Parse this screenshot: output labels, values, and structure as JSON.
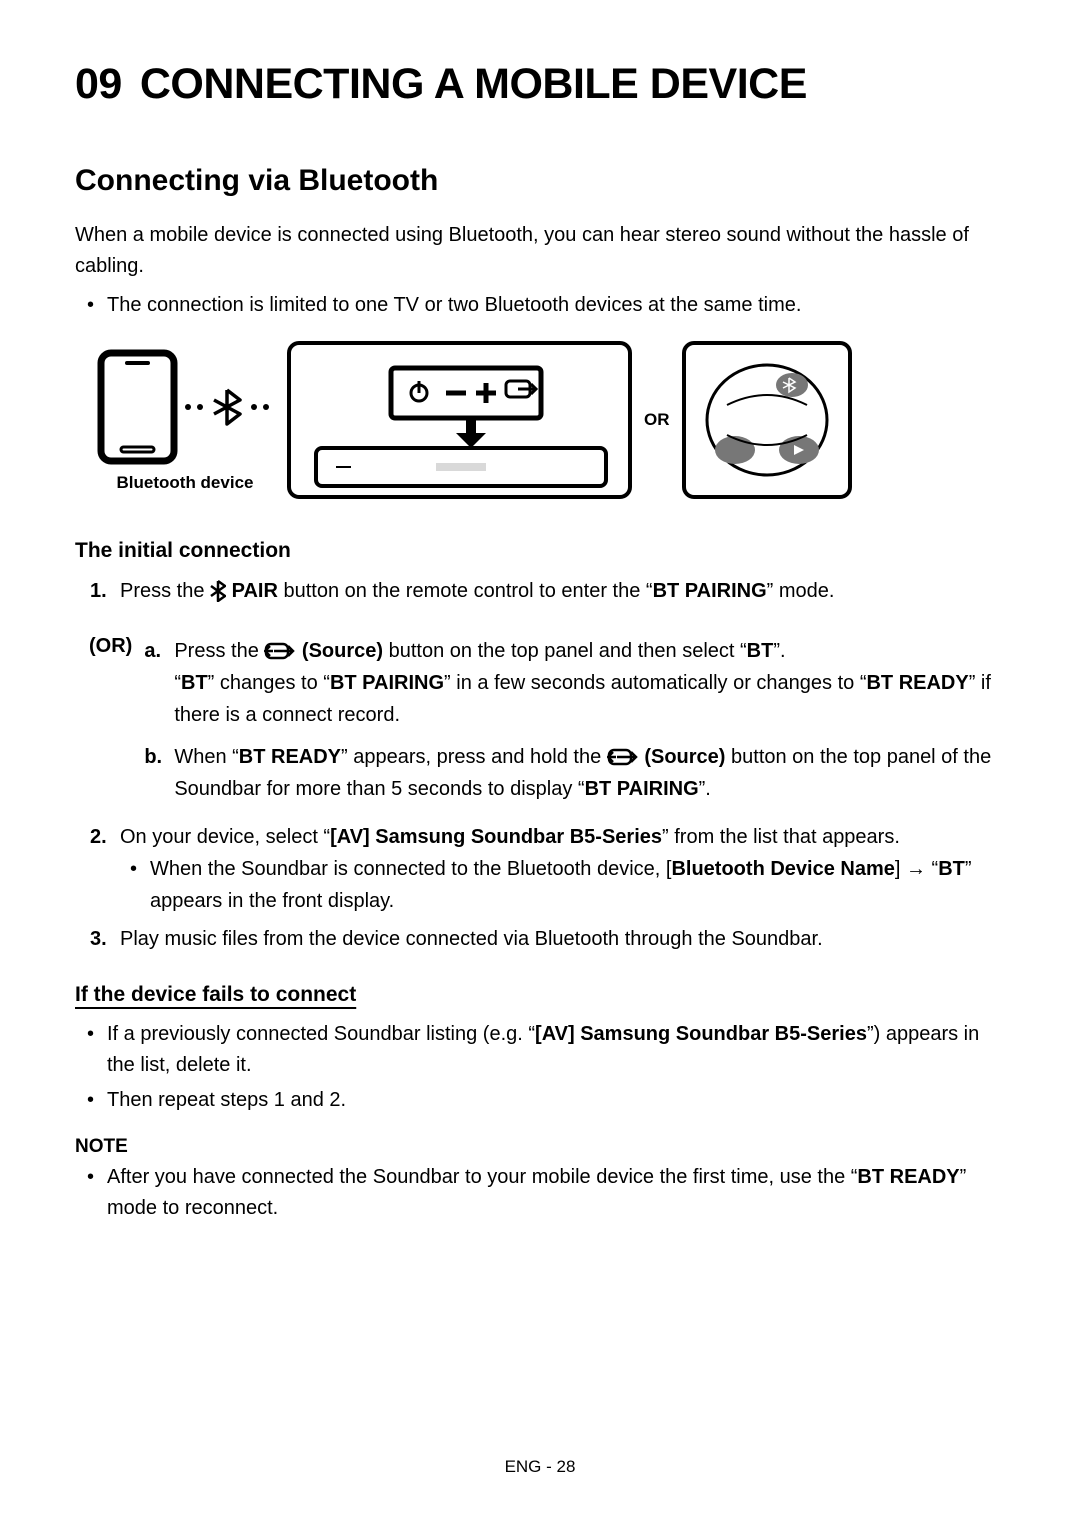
{
  "header": {
    "chapter_number": "09",
    "chapter_title": "CONNECTING A MOBILE DEVICE"
  },
  "section1": {
    "title": "Connecting via Bluetooth",
    "intro": "When a mobile device is connected using Bluetooth, you can hear stereo sound without the hassle of cabling.",
    "bullet1": "The connection is limited to one TV or two Bluetooth devices at the same time."
  },
  "figure": {
    "phone_label": "Bluetooth device",
    "or_label": "OR"
  },
  "initial": {
    "heading": "The initial connection",
    "step1_num": "1.",
    "step1_pre": "Press the ",
    "step1_pair": " PAIR",
    "step1_mid": " button on the remote control to enter the “",
    "step1_btpair": "BT PAIRING",
    "step1_end": "” mode.",
    "or_tag": "(OR)",
    "a_num": "a.",
    "a_pre": "Press the ",
    "a_src": " (Source)",
    "a_mid": " button on the top panel and then select “",
    "a_bt": "BT",
    "a_end": "”.",
    "a_line2_pre": "“",
    "a_line2_bt": "BT",
    "a_line2_mid": "” changes to “",
    "a_line2_btpair": "BT PAIRING",
    "a_line2_mid2": "” in a few seconds automatically or changes to “",
    "a_line2_btready": "BT READY",
    "a_line2_end": "” if there is a connect record.",
    "b_num": "b.",
    "b_pre": "When “",
    "b_btready": "BT READY",
    "b_mid": "” appears, press and hold the ",
    "b_src": " (Source)",
    "b_mid2": " button on the top panel of the Soundbar for more than 5 seconds to display “",
    "b_btpair": "BT PAIRING",
    "b_end": "”.",
    "step2_num": "2.",
    "step2_pre": "On your device, select “",
    "step2_device": "[AV] Samsung Soundbar B5-Series",
    "step2_end": "” from the list that appears.",
    "step2_sub_pre": "When the Soundbar is connected to the Bluetooth device, [",
    "step2_sub_name": "Bluetooth Device Name",
    "step2_sub_mid": "] → “",
    "step2_sub_bt": "BT",
    "step2_sub_end": "” appears in the front display.",
    "step3_num": "3.",
    "step3_text": "Play music files from the device connected via Bluetooth through the Soundbar."
  },
  "fails": {
    "heading": "If the device fails to connect",
    "b1_pre": "If a previously connected Soundbar listing (e.g. “",
    "b1_device": "[AV] Samsung Soundbar B5-Series",
    "b1_end": "”) appears in the list, delete it.",
    "b2": "Then repeat steps 1 and 2."
  },
  "note": {
    "heading": "NOTE",
    "b1_pre": "After you have connected the Soundbar to your mobile device the first time, use the “",
    "b1_btready": "BT READY",
    "b1_end": "” mode to reconnect."
  },
  "footer": {
    "text": "ENG - 28"
  }
}
